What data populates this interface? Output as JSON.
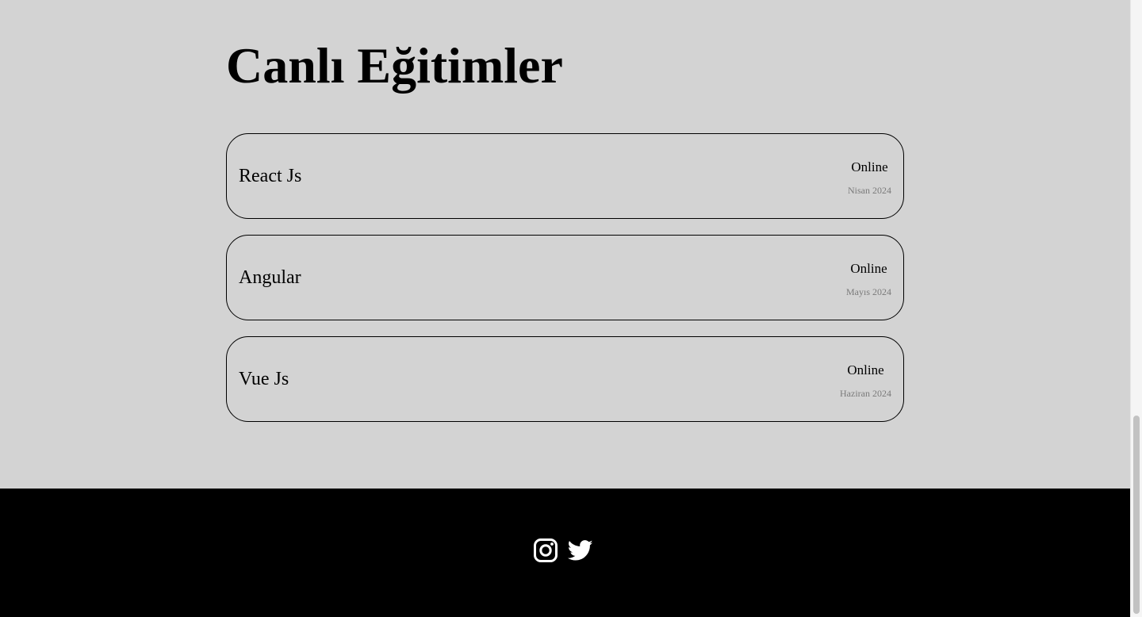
{
  "page": {
    "title": "Canlı Eğitimler"
  },
  "courses": [
    {
      "name": "React Js",
      "mode": "Online",
      "date": "Nisan 2024"
    },
    {
      "name": "Angular",
      "mode": "Online",
      "date": "Mayıs 2024"
    },
    {
      "name": "Vue Js",
      "mode": "Online",
      "date": "Haziran 2024"
    }
  ],
  "footer": {
    "social": [
      {
        "icon": "instagram-icon"
      },
      {
        "icon": "twitter-icon"
      }
    ]
  },
  "colors": {
    "background": "#d3d3d3",
    "footer": "#000000",
    "date_text": "#7a7a7a"
  }
}
